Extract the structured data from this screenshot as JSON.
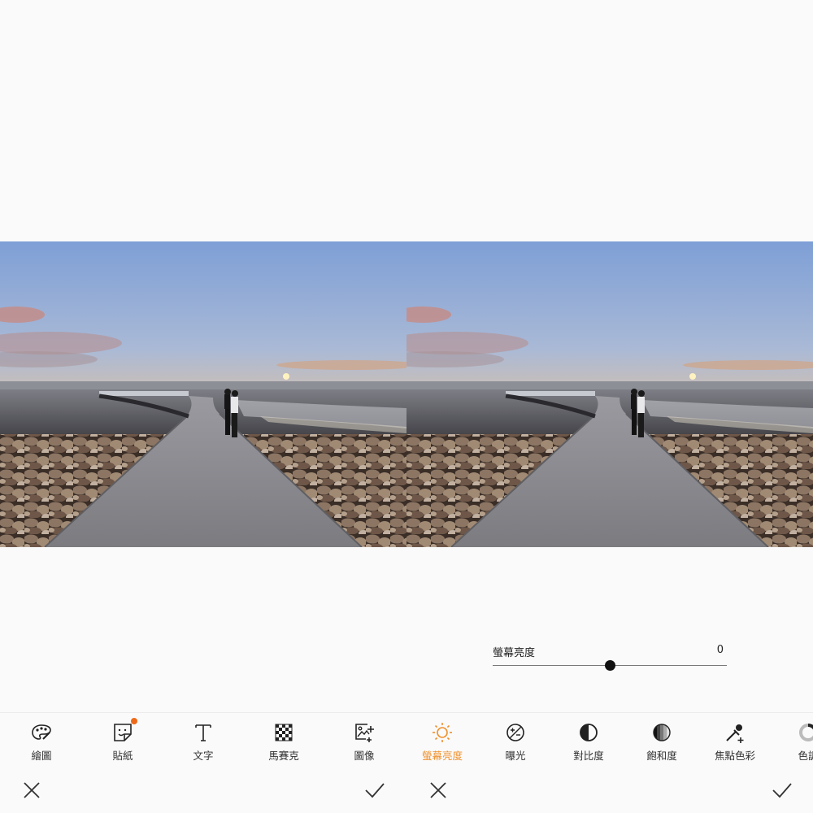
{
  "left_panel": {
    "tools": [
      {
        "label": "繪圖",
        "icon": "palette-icon"
      },
      {
        "label": "貼紙",
        "icon": "sticker-icon",
        "badge": true
      },
      {
        "label": "文字",
        "icon": "text-icon"
      },
      {
        "label": "馬賽克",
        "icon": "mosaic-icon"
      },
      {
        "label": "圖像",
        "icon": "add-image-icon"
      }
    ]
  },
  "right_panel": {
    "tools": [
      {
        "label": "螢幕亮度",
        "icon": "brightness-icon",
        "active": true
      },
      {
        "label": "曝光",
        "icon": "exposure-icon"
      },
      {
        "label": "對比度",
        "icon": "contrast-icon"
      },
      {
        "label": "飽和度",
        "icon": "saturation-icon"
      },
      {
        "label": "焦點色彩",
        "icon": "color-picker-icon"
      },
      {
        "label": "色調",
        "icon": "tone-icon"
      }
    ],
    "slider": {
      "label": "螢幕亮度",
      "value": "0",
      "position_fraction": 0.5
    }
  },
  "colors": {
    "accent": "#f0902c",
    "badge": "#ee6a1a"
  },
  "actions": {
    "cancel_icon": "close-icon",
    "confirm_icon": "check-icon"
  }
}
